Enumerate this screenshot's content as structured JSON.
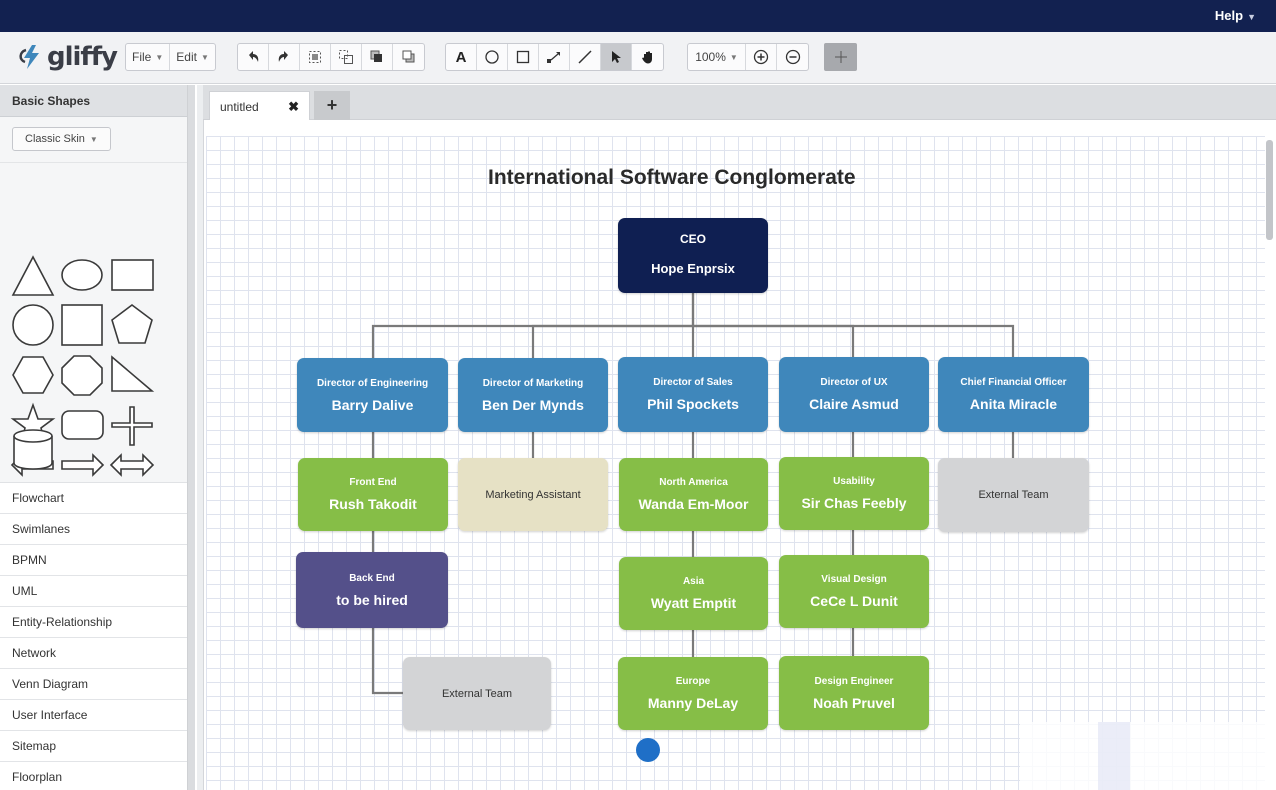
{
  "app": {
    "logo_text": "gliffy",
    "help_label": "Help"
  },
  "toolbar": {
    "file_label": "File",
    "edit_label": "Edit",
    "zoom_label": "100%",
    "tools": [
      "undo-icon",
      "redo-icon",
      "group-icon",
      "ungroup-icon",
      "bring-front-icon",
      "send-back-icon",
      "text-tool-icon",
      "ellipse-tool-icon",
      "rectangle-tool-icon",
      "connector-tool-icon",
      "line-tool-icon",
      "pointer-tool-icon",
      "hand-tool-icon",
      "zoom-in-icon",
      "zoom-out-icon",
      "grid-toggle-icon"
    ]
  },
  "sidebar": {
    "header": "Basic Shapes",
    "skin_label": "Classic Skin",
    "shape_icons": [
      "triangle-icon",
      "ellipse-icon",
      "rectangle-icon",
      "circle-icon",
      "square-icon",
      "pentagon-icon",
      "hexagon-icon",
      "octagon-icon",
      "right-triangle-icon",
      "star-icon",
      "rounded-rectangle-icon",
      "cross-icon",
      "left-arrow-icon",
      "right-arrow-icon",
      "double-arrow-icon",
      "cylinder-icon"
    ],
    "categories": [
      "Flowchart",
      "Swimlanes",
      "BPMN",
      "UML",
      "Entity-Relationship",
      "Network",
      "Venn Diagram",
      "User Interface",
      "Sitemap",
      "Floorplan"
    ]
  },
  "tabs": {
    "active_label": "untitled",
    "close_glyph": "✖",
    "add_glyph": "+"
  },
  "diagram": {
    "title": "International Software Conglomerate",
    "ceo": {
      "role": "CEO",
      "name": "Hope Enprsix"
    },
    "directors": [
      {
        "role": "Director of Engineering",
        "name": "Barry Dalive"
      },
      {
        "role": "Director of Marketing",
        "name": "Ben Der Mynds"
      },
      {
        "role": "Director of Sales",
        "name": "Phil Spockets"
      },
      {
        "role": "Director of UX",
        "name": "Claire Asmud"
      },
      {
        "role": "Chief Financial Officer",
        "name": "Anita Miracle"
      }
    ],
    "engineering": {
      "front_end": {
        "role": "Front End",
        "name": "Rush Takodit"
      },
      "back_end": {
        "role": "Back End",
        "name": "to be hired"
      },
      "external": "External Team"
    },
    "marketing": {
      "assistant": "Marketing Assistant"
    },
    "sales": {
      "north_america": {
        "role": "North America",
        "name": "Wanda Em-Moor"
      },
      "asia": {
        "role": "Asia",
        "name": "Wyatt Emptit"
      },
      "europe": {
        "role": "Europe",
        "name": "Manny DeLay"
      }
    },
    "ux": {
      "usability": {
        "role": "Usability",
        "name": "Sir Chas Feebly"
      },
      "visual_design": {
        "role": "Visual Design",
        "name": "CeCe L Dunit"
      },
      "design_engineer": {
        "role": "Design Engineer",
        "name": "Noah Pruvel"
      }
    },
    "finance": {
      "external": "External Team"
    }
  },
  "colors": {
    "topbar": "#122150",
    "ceo_box": "#0f1f52",
    "director_box": "#3f87bb",
    "team_green": "#86be47",
    "back_end_purple": "#54508a",
    "assistant_tan": "#e6e1c5",
    "external_gray": "#d3d4d6",
    "connector": "#7a7a7a"
  }
}
